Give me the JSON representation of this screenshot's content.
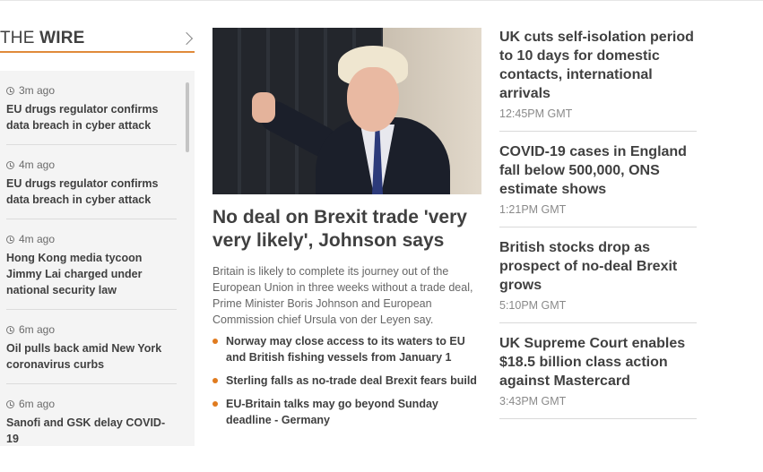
{
  "wire": {
    "title_prefix": "THE",
    "title_main": "WIRE",
    "items": [
      {
        "time": "3m ago",
        "headline": "EU drugs regulator confirms data breach in cyber attack"
      },
      {
        "time": "4m ago",
        "headline": "EU drugs regulator confirms data breach in cyber attack"
      },
      {
        "time": "4m ago",
        "headline": "Hong Kong media tycoon Jimmy Lai charged under national security law"
      },
      {
        "time": "6m ago",
        "headline": "Oil pulls back amid New York coronavirus curbs"
      },
      {
        "time": "6m ago",
        "headline": "Sanofi and GSK delay COVID-19"
      }
    ]
  },
  "lead": {
    "title": "No deal on Brexit trade 'very very likely', Johnson says",
    "summary": "Britain is likely to complete its journey out of the European Union in three weeks without a trade deal, Prime Minister Boris Johnson and European Commission chief Ursula von der Leyen say.",
    "bullets": [
      "Norway may close access to its waters to EU and British fishing vessels from January 1",
      "Sterling falls as no-trade deal Brexit fears build",
      "EU-Britain talks may go beyond Sunday deadline - Germany"
    ]
  },
  "side": {
    "items": [
      {
        "headline": "UK cuts self-isolation period to 10 days for domestic contacts, international arrivals",
        "time": "12:45PM GMT"
      },
      {
        "headline": "COVID-19 cases in England fall below 500,000, ONS estimate shows",
        "time": "1:21PM GMT"
      },
      {
        "headline": "British stocks drop as prospect of no-deal Brexit grows",
        "time": "5:10PM GMT"
      },
      {
        "headline": "UK Supreme Court enables $18.5 billion class action against Mastercard",
        "time": "3:43PM GMT"
      }
    ]
  },
  "colors": {
    "accent": "#e07b1f",
    "wire_panel_bg": "#f4f4f4",
    "text": "#404040"
  }
}
